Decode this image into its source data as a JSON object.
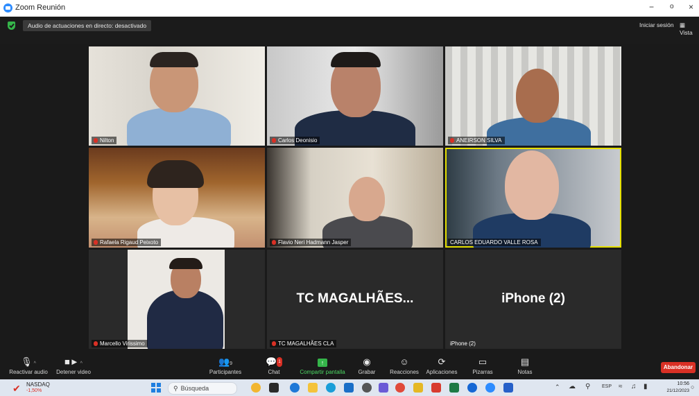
{
  "window": {
    "title": "Zoom Reunión",
    "controls": [
      "−",
      "o",
      "×"
    ]
  },
  "topbar": {
    "live_badge": "Audio de actuaciones en directo: desactivado",
    "signin": "Iniciar sesión",
    "view": "Vista"
  },
  "participants": [
    {
      "name": "Nilton"
    },
    {
      "name": "Carlos Deonisio"
    },
    {
      "name": "ANEIRSON SILVA"
    },
    {
      "name": "Rafaela Rigaud Peixoto"
    },
    {
      "name": "Flavio Neri Hadmann Jasper"
    },
    {
      "name": "CARLOS EDUARDO VALLE ROSA"
    },
    {
      "name": "Marcello Virissimo"
    },
    {
      "name": "TC MAGALHÃES CLA",
      "big_label": "TC  MAGALHÃES..."
    },
    {
      "name": "iPhone (2)",
      "big_label": "iPhone (2)"
    }
  ],
  "toolbar": {
    "unmute": "Reactivar audio",
    "stop_video": "Detener video",
    "participants": "Participantes",
    "participants_count": "9",
    "chat": "Chat",
    "chat_badge": "1",
    "share": "Compartir pantalla",
    "record": "Grabar",
    "reactions": "Reacciones",
    "apps": "Aplicaciones",
    "whiteboards": "Pizarras",
    "notes": "Notas",
    "leave": "Abandonar"
  },
  "taskbar": {
    "ticker_name": "NASDAQ",
    "ticker_change": "-1,50%",
    "search_placeholder": "Búsqueda",
    "language": "ESP",
    "time": "10:56",
    "date": "21/12/2023"
  },
  "colors": {
    "accent_green": "#4cd964",
    "leave_red": "#d93025",
    "active_speaker": "#e6e000",
    "zoom_blue": "#2d8cff"
  }
}
